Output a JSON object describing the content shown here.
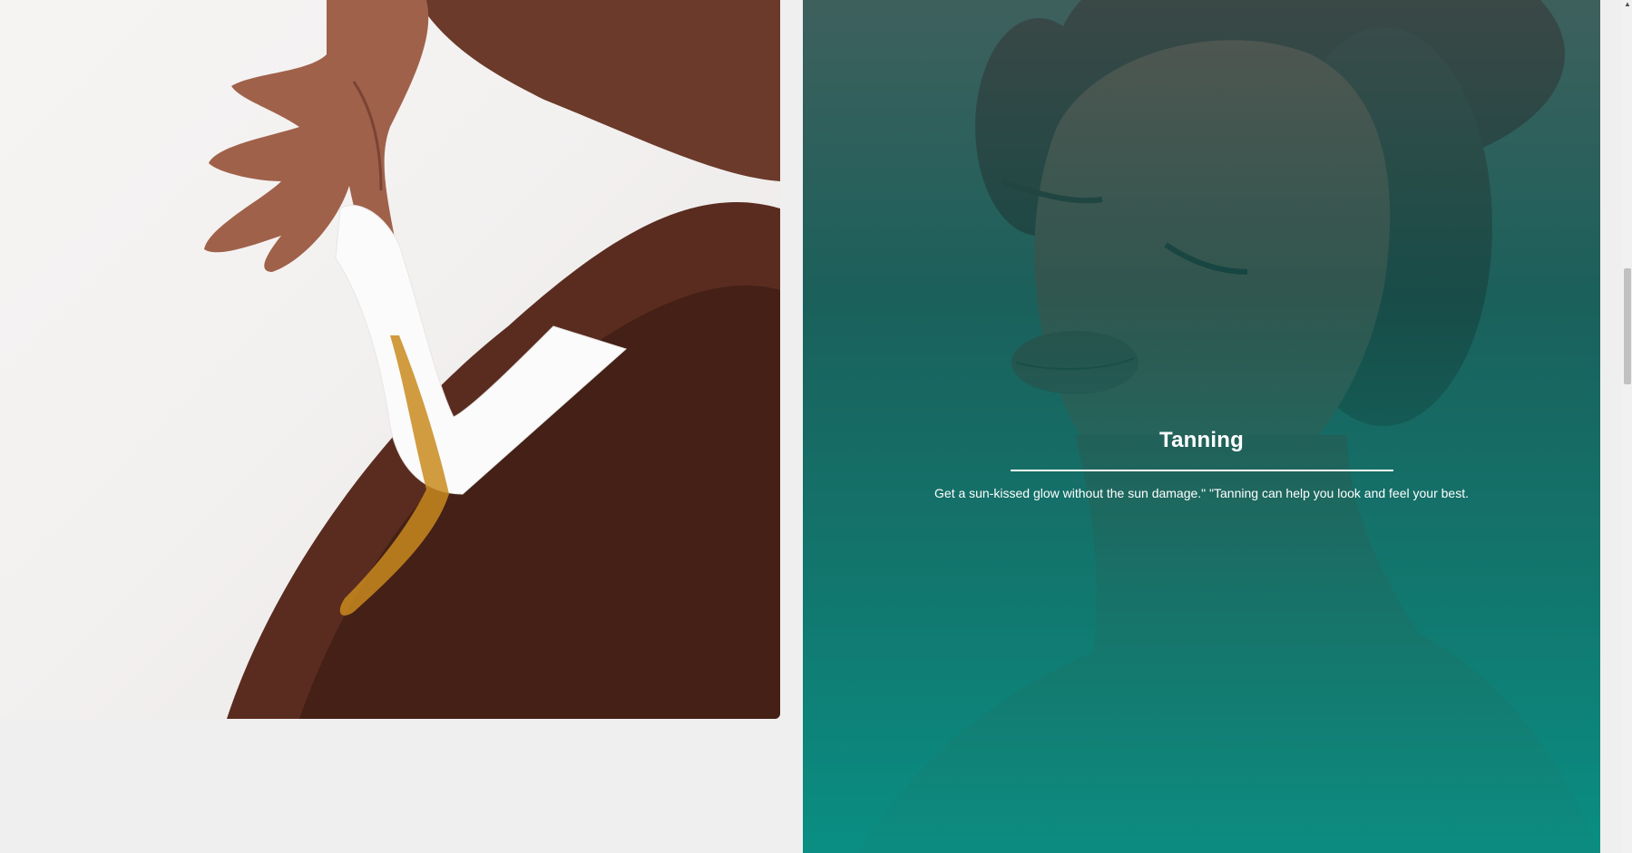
{
  "services": [
    {
      "image": "waxing-photo",
      "title": "",
      "description": ""
    },
    {
      "image": "tanning-photo",
      "title": "Tanning",
      "description": "Get a sun-kissed glow without the sun damage.\" \"Tanning can help you look and feel your best."
    }
  ],
  "colors": {
    "page_background": "#f0efef",
    "overlay_teal": "#0b8f84",
    "text": "#ffffff"
  },
  "scrollbar": {
    "arrow_icon": "up-arrow-icon"
  }
}
